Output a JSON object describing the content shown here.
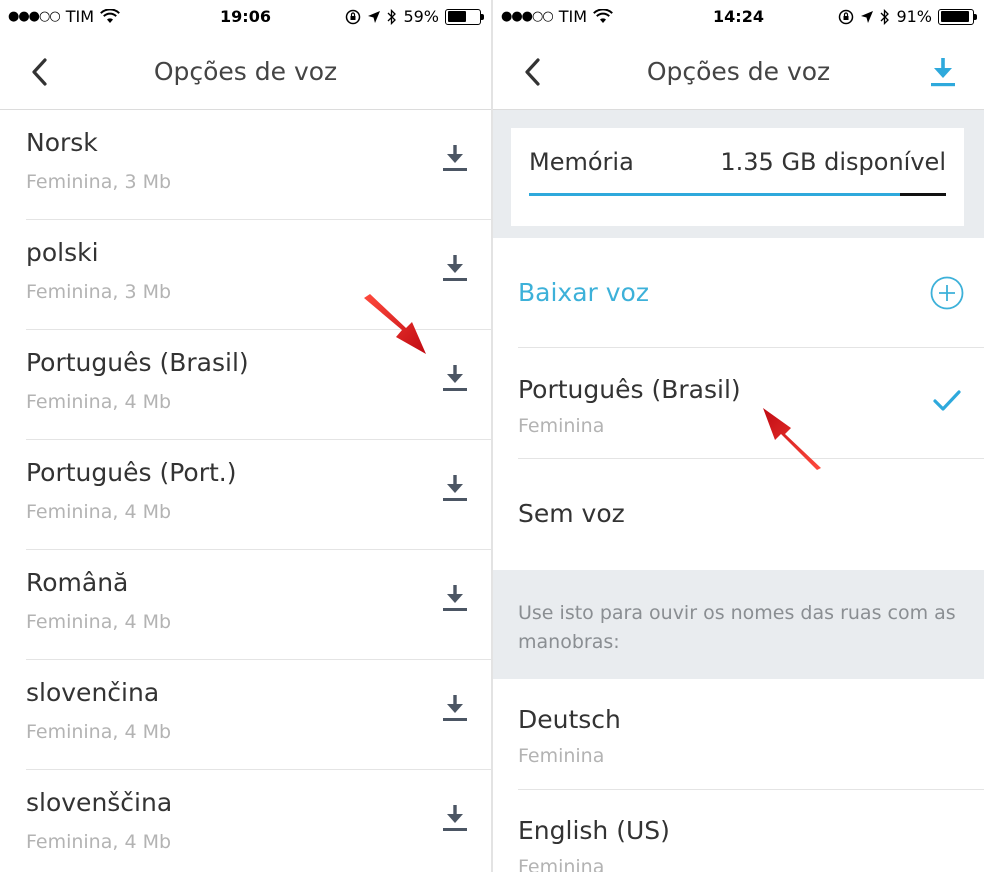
{
  "left_screen": {
    "status": {
      "carrier": "TIM",
      "time": "19:06",
      "battery": "59%",
      "battery_level": 0.59
    },
    "nav": {
      "title": "Opções de voz"
    },
    "voices": [
      {
        "name": "Norsk",
        "detail": "Feminina, 3 Mb"
      },
      {
        "name": "polski",
        "detail": "Feminina, 3 Mb"
      },
      {
        "name": "Português (Brasil)",
        "detail": "Feminina, 4 Mb"
      },
      {
        "name": "Português (Port.)",
        "detail": "Feminina, 4 Mb"
      },
      {
        "name": "Română",
        "detail": "Feminina, 4 Mb"
      },
      {
        "name": "slovenčina",
        "detail": "Feminina, 4 Mb"
      },
      {
        "name": "slovenščina",
        "detail": "Feminina, 4 Mb"
      }
    ]
  },
  "right_screen": {
    "status": {
      "carrier": "TIM",
      "time": "14:24",
      "battery": "91%",
      "battery_level": 0.91
    },
    "nav": {
      "title": "Opções de voz"
    },
    "memory": {
      "label": "Memória",
      "value": "1.35 GB disponível",
      "used_fraction": 0.89
    },
    "add_voice": {
      "label": "Baixar voz"
    },
    "selected_voice": {
      "name": "Português (Brasil)",
      "detail": "Feminina"
    },
    "no_voice": {
      "label": "Sem voz"
    },
    "street_names_info": "Use isto para ouvir os nomes das ruas com as manobras:",
    "street_voices": [
      {
        "name": "Deutsch",
        "detail": "Feminina"
      },
      {
        "name": "English (US)",
        "detail": "Feminina"
      }
    ]
  },
  "colors": {
    "accent": "#2ea9dc",
    "annotation_arrow": "#e0151b",
    "section_bg": "#e9ecef"
  },
  "icons": [
    "back-chevron-icon",
    "download-icon",
    "plus-circle-icon",
    "checkmark-icon",
    "wifi-icon",
    "location-icon",
    "bluetooth-icon",
    "lock-rotation-icon"
  ]
}
